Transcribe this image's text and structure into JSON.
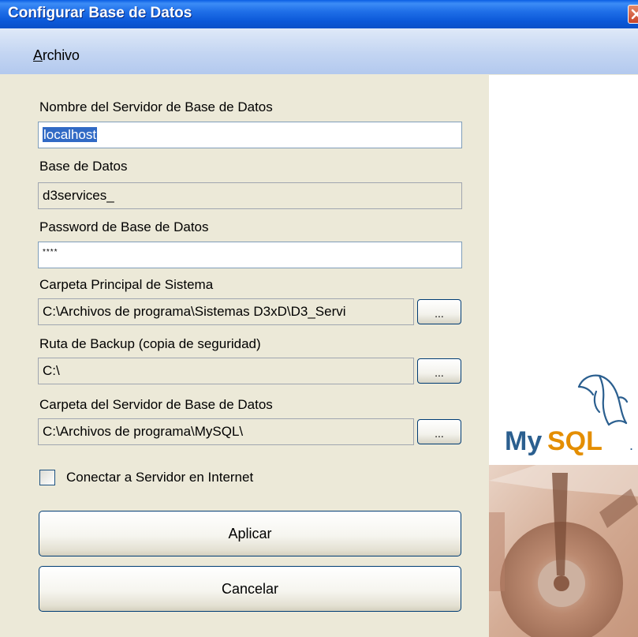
{
  "window": {
    "title": "Configurar Base de Datos"
  },
  "menu": {
    "file_label_first": "A",
    "file_label_rest": "rchivo"
  },
  "fields": {
    "server": {
      "label": "Nombre del Servidor de Base de Datos",
      "value": "localhost"
    },
    "database": {
      "label": "Base de Datos",
      "value": "d3services_"
    },
    "password": {
      "label": "Password de Base de Datos",
      "value": "****"
    },
    "main_folder": {
      "label": "Carpeta Principal de Sistema",
      "value": "C:\\Archivos de programa\\Sistemas D3xD\\D3_Servi"
    },
    "backup_path": {
      "label": "Ruta de Backup  (copia de seguridad)",
      "value": "C:\\"
    },
    "server_folder": {
      "label": "Carpeta del Servidor de Base de Datos",
      "value": "C:\\Archivos de programa\\MySQL\\"
    }
  },
  "browse_label": "...",
  "checkbox": {
    "label": "Conectar a Servidor en Internet",
    "checked": false
  },
  "buttons": {
    "apply": "Aplicar",
    "cancel": "Cancelar"
  },
  "logo": {
    "text": "MySQL",
    "text_color": "#2b5f8f",
    "accent_color": "#e48e00"
  },
  "colors": {
    "title_bar": "#0b58d8",
    "window_bg": "#ece9d8",
    "selection": "#316ac5"
  }
}
